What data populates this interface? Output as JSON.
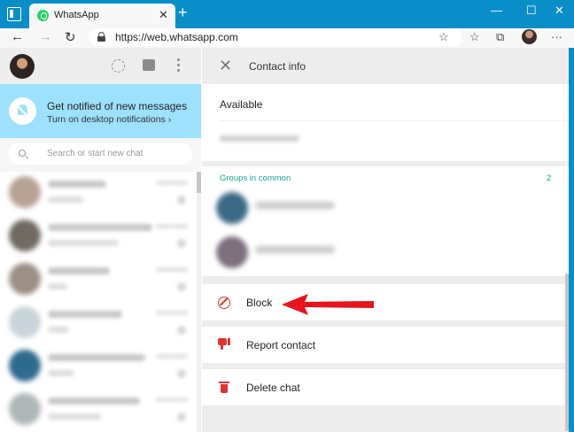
{
  "browser": {
    "tab_title": "WhatsApp",
    "tab_close": "✕",
    "new_tab": "+",
    "window_buttons": [
      "—",
      "☐",
      "✕"
    ],
    "url": "https://web.whatsapp.com",
    "nav": {
      "back": "←",
      "forward": "→",
      "refresh": "↻"
    },
    "toolbar_icons": [
      "star-add-icon",
      "collections-icon",
      "extensions-icon",
      "profile-avatar",
      "more-icon"
    ],
    "toolbar_glyphs": {
      "favorite": "☆",
      "favorites": "☆",
      "collections": "⧉",
      "more": "···"
    }
  },
  "sidebar": {
    "notify_title": "Get notified of new messages",
    "notify_sub": "Turn on desktop notifications ›",
    "search_placeholder": "Search or start new chat",
    "chats": [
      {
        "avatar_color": "#b8a396",
        "line1_w": 66,
        "line2_w": 40
      },
      {
        "avatar_color": "#6f6a62",
        "line1_w": 118,
        "line2_w": 80
      },
      {
        "avatar_color": "#9c8f84",
        "line1_w": 70,
        "line2_w": 22
      },
      {
        "avatar_color": "#c9d3d9",
        "line1_w": 84,
        "line2_w": 24
      },
      {
        "avatar_color": "#2f6b8f",
        "line1_w": 110,
        "line2_w": 30
      },
      {
        "avatar_color": "#aeb6b8",
        "line1_w": 104,
        "line2_w": 60
      }
    ]
  },
  "contact": {
    "header_title": "Contact info",
    "close_glyph": "✕",
    "about": "Available",
    "groups_label": "Groups in common",
    "groups_count": "2",
    "group_avatar_colors": [
      "#3c6a86",
      "#7d6f7c"
    ],
    "actions": {
      "block": "Block",
      "report": "Report contact",
      "delete": "Delete chat"
    }
  },
  "colors": {
    "browser_accent": "#0a8ec8",
    "notify_bg": "#9de1fe",
    "whatsapp_green": "#14a38b",
    "danger": "#df3333",
    "arrow": "#e5141d"
  }
}
